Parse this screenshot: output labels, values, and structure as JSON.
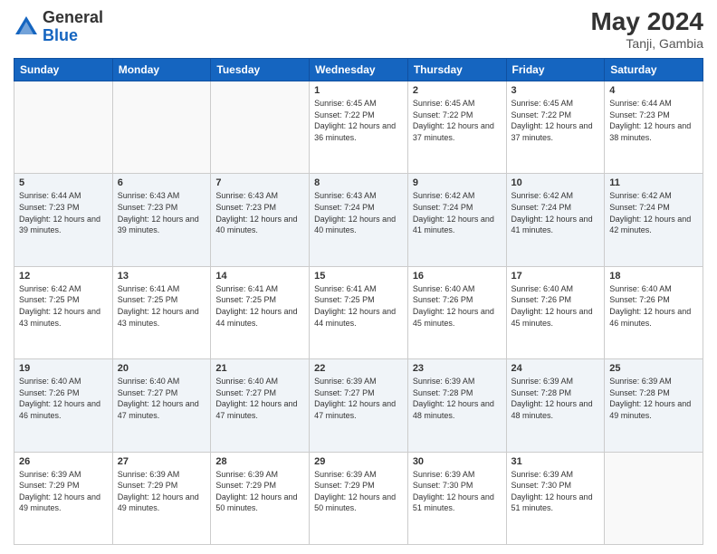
{
  "header": {
    "logo_general": "General",
    "logo_blue": "Blue",
    "month_year": "May 2024",
    "location": "Tanji, Gambia"
  },
  "days_of_week": [
    "Sunday",
    "Monday",
    "Tuesday",
    "Wednesday",
    "Thursday",
    "Friday",
    "Saturday"
  ],
  "weeks": [
    {
      "alt": false,
      "days": [
        {
          "num": "",
          "sunrise": "",
          "sunset": "",
          "daylight": ""
        },
        {
          "num": "",
          "sunrise": "",
          "sunset": "",
          "daylight": ""
        },
        {
          "num": "",
          "sunrise": "",
          "sunset": "",
          "daylight": ""
        },
        {
          "num": "1",
          "sunrise": "Sunrise: 6:45 AM",
          "sunset": "Sunset: 7:22 PM",
          "daylight": "Daylight: 12 hours and 36 minutes."
        },
        {
          "num": "2",
          "sunrise": "Sunrise: 6:45 AM",
          "sunset": "Sunset: 7:22 PM",
          "daylight": "Daylight: 12 hours and 37 minutes."
        },
        {
          "num": "3",
          "sunrise": "Sunrise: 6:45 AM",
          "sunset": "Sunset: 7:22 PM",
          "daylight": "Daylight: 12 hours and 37 minutes."
        },
        {
          "num": "4",
          "sunrise": "Sunrise: 6:44 AM",
          "sunset": "Sunset: 7:23 PM",
          "daylight": "Daylight: 12 hours and 38 minutes."
        }
      ]
    },
    {
      "alt": true,
      "days": [
        {
          "num": "5",
          "sunrise": "Sunrise: 6:44 AM",
          "sunset": "Sunset: 7:23 PM",
          "daylight": "Daylight: 12 hours and 39 minutes."
        },
        {
          "num": "6",
          "sunrise": "Sunrise: 6:43 AM",
          "sunset": "Sunset: 7:23 PM",
          "daylight": "Daylight: 12 hours and 39 minutes."
        },
        {
          "num": "7",
          "sunrise": "Sunrise: 6:43 AM",
          "sunset": "Sunset: 7:23 PM",
          "daylight": "Daylight: 12 hours and 40 minutes."
        },
        {
          "num": "8",
          "sunrise": "Sunrise: 6:43 AM",
          "sunset": "Sunset: 7:24 PM",
          "daylight": "Daylight: 12 hours and 40 minutes."
        },
        {
          "num": "9",
          "sunrise": "Sunrise: 6:42 AM",
          "sunset": "Sunset: 7:24 PM",
          "daylight": "Daylight: 12 hours and 41 minutes."
        },
        {
          "num": "10",
          "sunrise": "Sunrise: 6:42 AM",
          "sunset": "Sunset: 7:24 PM",
          "daylight": "Daylight: 12 hours and 41 minutes."
        },
        {
          "num": "11",
          "sunrise": "Sunrise: 6:42 AM",
          "sunset": "Sunset: 7:24 PM",
          "daylight": "Daylight: 12 hours and 42 minutes."
        }
      ]
    },
    {
      "alt": false,
      "days": [
        {
          "num": "12",
          "sunrise": "Sunrise: 6:42 AM",
          "sunset": "Sunset: 7:25 PM",
          "daylight": "Daylight: 12 hours and 43 minutes."
        },
        {
          "num": "13",
          "sunrise": "Sunrise: 6:41 AM",
          "sunset": "Sunset: 7:25 PM",
          "daylight": "Daylight: 12 hours and 43 minutes."
        },
        {
          "num": "14",
          "sunrise": "Sunrise: 6:41 AM",
          "sunset": "Sunset: 7:25 PM",
          "daylight": "Daylight: 12 hours and 44 minutes."
        },
        {
          "num": "15",
          "sunrise": "Sunrise: 6:41 AM",
          "sunset": "Sunset: 7:25 PM",
          "daylight": "Daylight: 12 hours and 44 minutes."
        },
        {
          "num": "16",
          "sunrise": "Sunrise: 6:40 AM",
          "sunset": "Sunset: 7:26 PM",
          "daylight": "Daylight: 12 hours and 45 minutes."
        },
        {
          "num": "17",
          "sunrise": "Sunrise: 6:40 AM",
          "sunset": "Sunset: 7:26 PM",
          "daylight": "Daylight: 12 hours and 45 minutes."
        },
        {
          "num": "18",
          "sunrise": "Sunrise: 6:40 AM",
          "sunset": "Sunset: 7:26 PM",
          "daylight": "Daylight: 12 hours and 46 minutes."
        }
      ]
    },
    {
      "alt": true,
      "days": [
        {
          "num": "19",
          "sunrise": "Sunrise: 6:40 AM",
          "sunset": "Sunset: 7:26 PM",
          "daylight": "Daylight: 12 hours and 46 minutes."
        },
        {
          "num": "20",
          "sunrise": "Sunrise: 6:40 AM",
          "sunset": "Sunset: 7:27 PM",
          "daylight": "Daylight: 12 hours and 47 minutes."
        },
        {
          "num": "21",
          "sunrise": "Sunrise: 6:40 AM",
          "sunset": "Sunset: 7:27 PM",
          "daylight": "Daylight: 12 hours and 47 minutes."
        },
        {
          "num": "22",
          "sunrise": "Sunrise: 6:39 AM",
          "sunset": "Sunset: 7:27 PM",
          "daylight": "Daylight: 12 hours and 47 minutes."
        },
        {
          "num": "23",
          "sunrise": "Sunrise: 6:39 AM",
          "sunset": "Sunset: 7:28 PM",
          "daylight": "Daylight: 12 hours and 48 minutes."
        },
        {
          "num": "24",
          "sunrise": "Sunrise: 6:39 AM",
          "sunset": "Sunset: 7:28 PM",
          "daylight": "Daylight: 12 hours and 48 minutes."
        },
        {
          "num": "25",
          "sunrise": "Sunrise: 6:39 AM",
          "sunset": "Sunset: 7:28 PM",
          "daylight": "Daylight: 12 hours and 49 minutes."
        }
      ]
    },
    {
      "alt": false,
      "days": [
        {
          "num": "26",
          "sunrise": "Sunrise: 6:39 AM",
          "sunset": "Sunset: 7:29 PM",
          "daylight": "Daylight: 12 hours and 49 minutes."
        },
        {
          "num": "27",
          "sunrise": "Sunrise: 6:39 AM",
          "sunset": "Sunset: 7:29 PM",
          "daylight": "Daylight: 12 hours and 49 minutes."
        },
        {
          "num": "28",
          "sunrise": "Sunrise: 6:39 AM",
          "sunset": "Sunset: 7:29 PM",
          "daylight": "Daylight: 12 hours and 50 minutes."
        },
        {
          "num": "29",
          "sunrise": "Sunrise: 6:39 AM",
          "sunset": "Sunset: 7:29 PM",
          "daylight": "Daylight: 12 hours and 50 minutes."
        },
        {
          "num": "30",
          "sunrise": "Sunrise: 6:39 AM",
          "sunset": "Sunset: 7:30 PM",
          "daylight": "Daylight: 12 hours and 51 minutes."
        },
        {
          "num": "31",
          "sunrise": "Sunrise: 6:39 AM",
          "sunset": "Sunset: 7:30 PM",
          "daylight": "Daylight: 12 hours and 51 minutes."
        },
        {
          "num": "",
          "sunrise": "",
          "sunset": "",
          "daylight": ""
        }
      ]
    }
  ]
}
